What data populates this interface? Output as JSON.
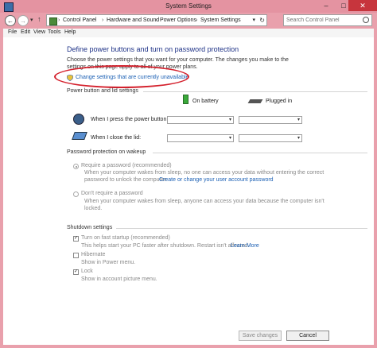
{
  "window": {
    "title": "System Settings",
    "minimize_glyph": "–",
    "maximize_glyph": "□",
    "close_glyph": "✕"
  },
  "nav": {
    "back_glyph": "←",
    "forward_glyph": "→",
    "dropdown_glyph": "▾",
    "up_glyph": "↑"
  },
  "address": {
    "separator": "›",
    "crumbs": [
      "Control Panel",
      "Hardware and Sound",
      "Power Options",
      "System Settings"
    ],
    "dropdown_glyph": "▾",
    "refresh_glyph": "↻"
  },
  "search": {
    "placeholder": "Search Control Panel"
  },
  "menu": {
    "file": "File",
    "edit": "Edit",
    "view": "View",
    "tools": "Tools",
    "help": "Help"
  },
  "page": {
    "heading": "Define power buttons and turn on password protection",
    "description": "Choose the power settings that you want for your computer. The changes you make to the settings on this page apply to all of your power plans.",
    "change_link": "Change settings that are currently unavailable"
  },
  "power_section": {
    "title": "Power button and lid settings",
    "col_battery": "On battery",
    "col_plugged": "Plugged in",
    "power_button_label": "When I press the power button:",
    "lid_label": "When I close the lid:"
  },
  "password_section": {
    "title": "Password protection on wakeup",
    "require_label": "Require a password (recommended)",
    "require_desc_1": "When your computer wakes from sleep, no one can access your data without entering the correct",
    "require_desc_2": "password to unlock the computer.",
    "require_link": "Create or change your user account password",
    "dont_label": "Don't require a password",
    "dont_desc_1": "When your computer wakes from sleep, anyone can access your data because the computer isn't",
    "dont_desc_2": "locked."
  },
  "shutdown_section": {
    "title": "Shutdown settings",
    "check_glyph": "✓",
    "fast_startup_label": "Turn on fast startup (recommended)",
    "fast_startup_desc": "This helps start your PC faster after shutdown. Restart isn't affected.",
    "learn_more": "Learn More",
    "hibernate_label": "Hibernate",
    "hibernate_desc": "Show in Power menu.",
    "lock_label": "Lock",
    "lock_desc": "Show in account picture menu."
  },
  "buttons": {
    "save": "Save changes",
    "cancel": "Cancel"
  },
  "colors": {
    "accent": "#1e3287",
    "link": "#1a5fb4",
    "highlight": "#d4202c"
  }
}
